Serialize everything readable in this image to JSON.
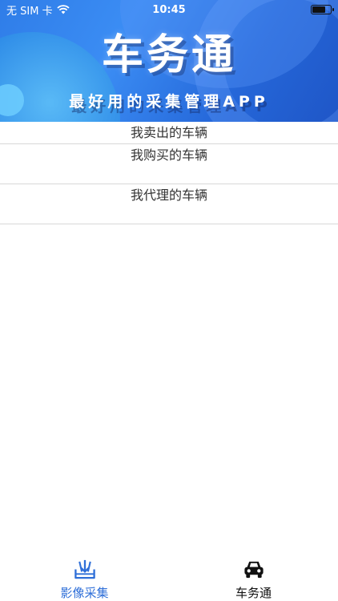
{
  "status_bar": {
    "carrier": "无 SIM 卡",
    "time": "10:45"
  },
  "banner": {
    "title": "车务通",
    "subtitle": "最好用的采集管理APP"
  },
  "menu": {
    "items": [
      {
        "label": "我卖出的车辆"
      },
      {
        "label": "我购买的车辆"
      },
      {
        "label": "我代理的车辆"
      }
    ]
  },
  "tabbar": {
    "tabs": [
      {
        "label": "影像采集",
        "icon": "image-collect-icon",
        "active": true
      },
      {
        "label": "车务通",
        "icon": "car-icon",
        "active": false
      }
    ]
  },
  "colors": {
    "accent": "#2f6fd8",
    "banner": "#2f7de8",
    "divider": "#d8d8d8"
  }
}
